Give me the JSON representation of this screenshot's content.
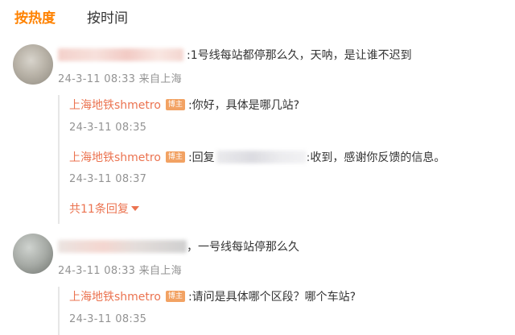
{
  "tabs": {
    "hot": "按热度",
    "time": "按时间"
  },
  "comments": [
    {
      "text": ":1号线每站都停那么久，天呐，是让谁不迟到",
      "meta": "24-3-11 08:33 来自上海",
      "replies": [
        {
          "author": "上海地铁shmetro",
          "badge": "博主",
          "text": ":你好，具体是哪几站?",
          "time": "24-3-11 08:35"
        },
        {
          "author": "上海地铁shmetro",
          "badge": "博主",
          "prefix": ":回复",
          "text": ":收到，感谢你反馈的信息。",
          "time": "24-3-11 08:37"
        }
      ],
      "more": "共11条回复"
    },
    {
      "text": "，一号线每站停那么久",
      "meta": "24-3-11 08:33 来自上海",
      "replies": [
        {
          "author": "上海地铁shmetro",
          "badge": "博主",
          "text": ":请问是具体哪个区段？哪个车站?",
          "time": "24-3-11 08:35"
        }
      ]
    }
  ]
}
